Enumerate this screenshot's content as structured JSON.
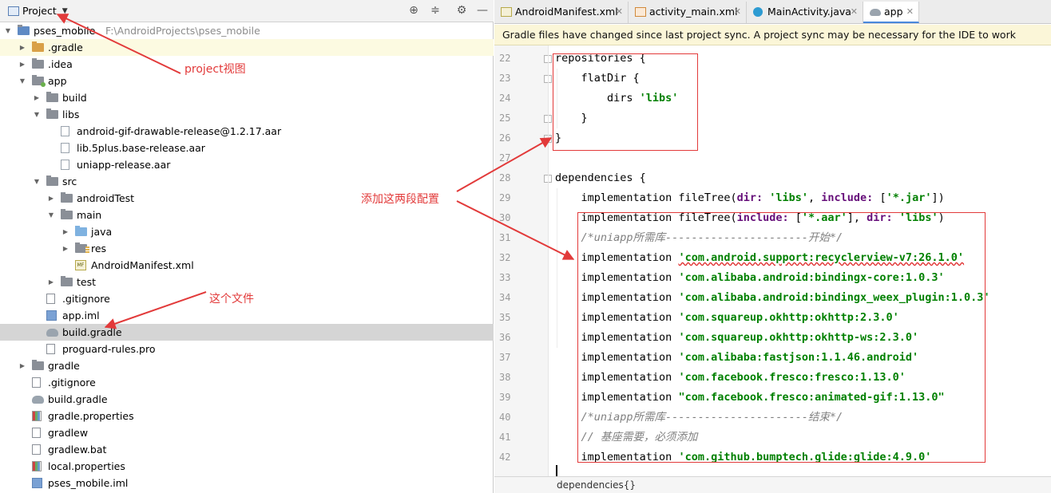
{
  "project_panel": {
    "view_label": "Project",
    "tree": [
      {
        "label": "pses_mobile",
        "path": "F:\\AndroidProjects\\pses_mobile",
        "depth": 0,
        "arrow": "▼",
        "icon": "project"
      },
      {
        "label": ".gradle",
        "depth": 1,
        "arrow": "▶",
        "icon": "folder-orange",
        "highlight": true
      },
      {
        "label": ".idea",
        "depth": 1,
        "arrow": "▶",
        "icon": "folder"
      },
      {
        "label": "app",
        "depth": 1,
        "arrow": "▼",
        "icon": "module"
      },
      {
        "label": "build",
        "depth": 2,
        "arrow": "▶",
        "icon": "folder"
      },
      {
        "label": "libs",
        "depth": 2,
        "arrow": "▼",
        "icon": "folder"
      },
      {
        "label": "android-gif-drawable-release@1.2.17.aar",
        "depth": 3,
        "arrow": "",
        "icon": "aar"
      },
      {
        "label": "lib.5plus.base-release.aar",
        "depth": 3,
        "arrow": "",
        "icon": "aar"
      },
      {
        "label": "uniapp-release.aar",
        "depth": 3,
        "arrow": "",
        "icon": "aar"
      },
      {
        "label": "src",
        "depth": 2,
        "arrow": "▼",
        "icon": "folder"
      },
      {
        "label": "androidTest",
        "depth": 3,
        "arrow": "▶",
        "icon": "folder"
      },
      {
        "label": "main",
        "depth": 3,
        "arrow": "▼",
        "icon": "folder"
      },
      {
        "label": "java",
        "depth": 4,
        "arrow": "▶",
        "icon": "folder-blue"
      },
      {
        "label": "res",
        "depth": 4,
        "arrow": "▶",
        "icon": "res"
      },
      {
        "label": "AndroidManifest.xml",
        "depth": 4,
        "arrow": "",
        "icon": "manifest"
      },
      {
        "label": "test",
        "depth": 3,
        "arrow": "▶",
        "icon": "folder"
      },
      {
        "label": ".gitignore",
        "depth": 2,
        "arrow": "",
        "icon": "gitignore"
      },
      {
        "label": "app.iml",
        "depth": 2,
        "arrow": "",
        "icon": "iml"
      },
      {
        "label": "build.gradle",
        "depth": 2,
        "arrow": "",
        "icon": "gradle",
        "selected": true
      },
      {
        "label": "proguard-rules.pro",
        "depth": 2,
        "arrow": "",
        "icon": "file"
      },
      {
        "label": "gradle",
        "depth": 1,
        "arrow": "▶",
        "icon": "folder"
      },
      {
        "label": ".gitignore",
        "depth": 1,
        "arrow": "",
        "icon": "gitignore"
      },
      {
        "label": "build.gradle",
        "depth": 1,
        "arrow": "",
        "icon": "gradle"
      },
      {
        "label": "gradle.properties",
        "depth": 1,
        "arrow": "",
        "icon": "props"
      },
      {
        "label": "gradlew",
        "depth": 1,
        "arrow": "",
        "icon": "file"
      },
      {
        "label": "gradlew.bat",
        "depth": 1,
        "arrow": "",
        "icon": "file"
      },
      {
        "label": "local.properties",
        "depth": 1,
        "arrow": "",
        "icon": "props"
      },
      {
        "label": "pses_mobile.iml",
        "depth": 1,
        "arrow": "",
        "icon": "iml"
      }
    ]
  },
  "editor": {
    "tabs": [
      {
        "label": "AndroidManifest.xml",
        "icon": "manifest-icon",
        "active": false
      },
      {
        "label": "activity_main.xml",
        "icon": "xml-icon",
        "active": false
      },
      {
        "label": "MainActivity.java",
        "icon": "java-class-icon",
        "active": false
      },
      {
        "label": "app",
        "icon": "gradle-icon",
        "active": true
      }
    ],
    "notice": "Gradle files have changed since last project sync. A project sync may be necessary for the IDE to work properly.",
    "lines": [
      {
        "n": "22",
        "segs": [
          [
            "plain",
            "repositories {"
          ]
        ]
      },
      {
        "n": "23",
        "segs": [
          [
            "plain",
            "    flatDir {"
          ]
        ]
      },
      {
        "n": "24",
        "segs": [
          [
            "plain",
            "        dirs "
          ],
          [
            "str",
            "'libs'"
          ]
        ]
      },
      {
        "n": "25",
        "segs": [
          [
            "plain",
            "    }"
          ]
        ]
      },
      {
        "n": "26",
        "segs": [
          [
            "plain",
            "}"
          ]
        ]
      },
      {
        "n": "27",
        "segs": []
      },
      {
        "n": "28",
        "segs": [
          [
            "plain",
            "dependencies {"
          ]
        ]
      },
      {
        "n": "29",
        "segs": [
          [
            "plain",
            "    implementation fileTree("
          ],
          [
            "kw",
            "dir:"
          ],
          [
            "plain",
            " "
          ],
          [
            "str",
            "'libs'"
          ],
          [
            "plain",
            ", "
          ],
          [
            "kw",
            "include:"
          ],
          [
            "plain",
            " ["
          ],
          [
            "str",
            "'*.jar'"
          ],
          [
            "plain",
            "])"
          ]
        ]
      },
      {
        "n": "30",
        "segs": [
          [
            "plain",
            "    implementation fileTree("
          ],
          [
            "kw",
            "include:"
          ],
          [
            "plain",
            " ["
          ],
          [
            "str",
            "'*.aar'"
          ],
          [
            "plain",
            "], "
          ],
          [
            "kw",
            "dir:"
          ],
          [
            "plain",
            " "
          ],
          [
            "str",
            "'libs'"
          ],
          [
            "plain",
            ")"
          ]
        ]
      },
      {
        "n": "31",
        "segs": [
          [
            "cmt",
            "    /*uniapp所需库----------------------开始*/"
          ]
        ]
      },
      {
        "n": "32",
        "segs": [
          [
            "plain",
            "    implementation "
          ],
          [
            "strsq",
            "'com.android.support:recyclerview-v7:26.1.0'"
          ]
        ]
      },
      {
        "n": "33",
        "segs": [
          [
            "plain",
            "    implementation "
          ],
          [
            "str",
            "'com.alibaba.android:bindingx-core:1.0.3'"
          ]
        ]
      },
      {
        "n": "34",
        "segs": [
          [
            "plain",
            "    implementation "
          ],
          [
            "str",
            "'com.alibaba.android:bindingx_weex_plugin:1.0.3'"
          ]
        ]
      },
      {
        "n": "35",
        "segs": [
          [
            "plain",
            "    implementation "
          ],
          [
            "str",
            "'com.squareup.okhttp:okhttp:2.3.0'"
          ]
        ]
      },
      {
        "n": "36",
        "segs": [
          [
            "plain",
            "    implementation "
          ],
          [
            "str",
            "'com.squareup.okhttp:okhttp-ws:2.3.0'"
          ]
        ]
      },
      {
        "n": "37",
        "segs": [
          [
            "plain",
            "    implementation "
          ],
          [
            "str",
            "'com.alibaba:fastjson:1.1.46.android'"
          ]
        ]
      },
      {
        "n": "38",
        "segs": [
          [
            "plain",
            "    implementation "
          ],
          [
            "str",
            "'com.facebook.fresco:fresco:1.13.0'"
          ]
        ]
      },
      {
        "n": "39",
        "segs": [
          [
            "plain",
            "    implementation "
          ],
          [
            "str",
            "\"com.facebook.fresco:animated-gif:1.13.0\""
          ]
        ]
      },
      {
        "n": "40",
        "segs": [
          [
            "cmt",
            "    /*uniapp所需库----------------------结束*/"
          ]
        ]
      },
      {
        "n": "41",
        "segs": [
          [
            "cmt",
            "    // 基座需要，必须添加"
          ]
        ]
      },
      {
        "n": "42",
        "segs": [
          [
            "plain",
            "    implementation "
          ],
          [
            "str",
            "'com.github.bumptech.glide:glide:4.9.0'"
          ]
        ]
      }
    ],
    "breadcrumb": "dependencies{}"
  },
  "annotations": {
    "project_view": "project视图",
    "add_config": "添加这两段配置",
    "this_file": "这个文件",
    "color": "#e23a3a"
  }
}
